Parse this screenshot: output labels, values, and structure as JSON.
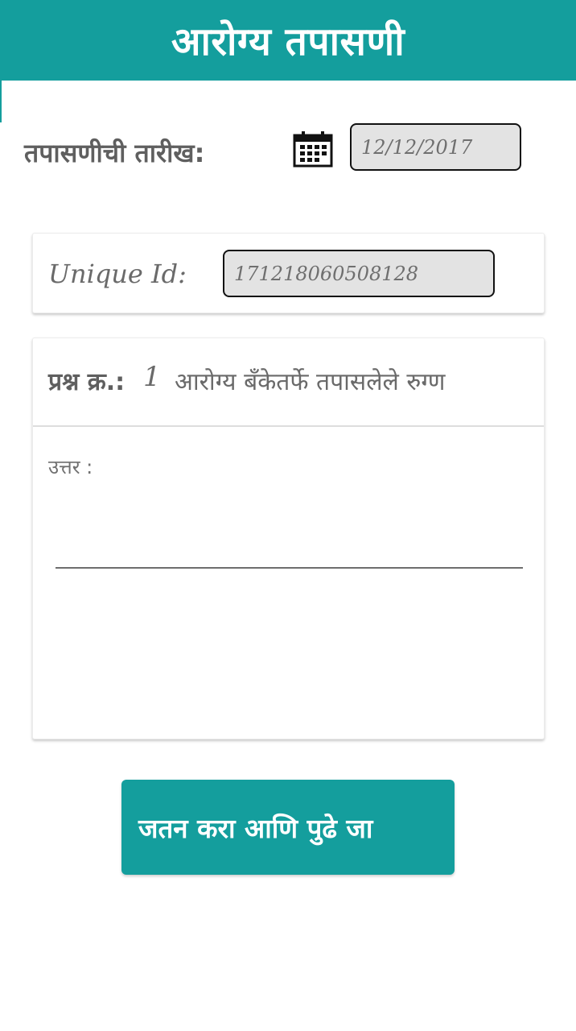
{
  "header": {
    "title": "आरोग्य तपासणी"
  },
  "date_section": {
    "label": "तपासणीची तारीख:",
    "icon": "calendar-icon",
    "value": "12/12/2017"
  },
  "unique_id": {
    "label": "Unique Id:",
    "value": "171218060508128"
  },
  "question": {
    "prefix": "प्रश्न क्र.:",
    "number": "1",
    "text": "आरोग्य बँकेतर्फे तपासलेले रुग्ण"
  },
  "answer": {
    "label": "उत्तर :",
    "value": ""
  },
  "submit_button": {
    "label": "जतन करा आणि पुढे जा"
  },
  "colors": {
    "primary": "#149e9d",
    "field_bg": "#e3e3e3",
    "text_gray": "#5f5f5f"
  }
}
